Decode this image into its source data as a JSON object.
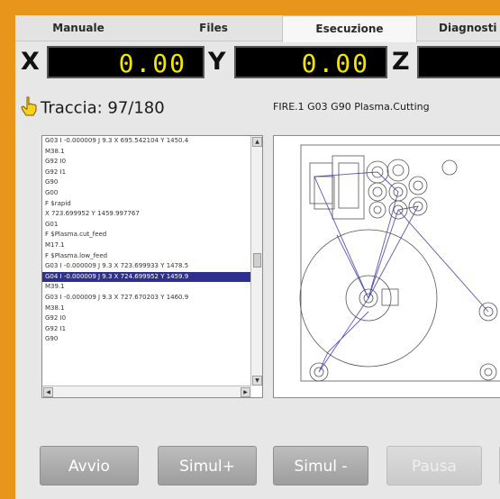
{
  "tabs": [
    {
      "label": "Manuale"
    },
    {
      "label": "Files"
    },
    {
      "label": "Esecuzione"
    },
    {
      "label": "Diagnosti"
    }
  ],
  "active_tab": "Esecuzione",
  "dro": {
    "x": {
      "axis": "X",
      "value": "0.00"
    },
    "y": {
      "axis": "Y",
      "value": "0.00"
    },
    "z": {
      "axis": "Z",
      "value": ""
    }
  },
  "trace": {
    "label": "Traccia: 97/180",
    "icon": "hand-pointer-icon"
  },
  "status_line": "FIRE.1  G03  G90  Plasma.Cutting",
  "gcode_lines": [
    "G03 I -0.000009 J 9.3 X 695.542104 Y 1450.4",
    "M38.1",
    "G92 I0",
    "G92 I1",
    "G90",
    "G00",
    "F $rapid",
    "X 723.699952 Y 1459.997767",
    "G01",
    "F $Plasma.cut_feed",
    "M17.1",
    "F $Plasma.low_feed",
    "G03 I -0.000009 J 9.3 X 723.699933 Y 1478.5",
    "G04 I -0.000009 J 9.3 X 724.699952 Y 1459.9",
    "M39.1",
    "G03 I -0.000009 J 9.3 X 727.670203 Y 1460.9",
    "M38.1",
    "G92 I0",
    "G92 I1",
    "G90"
  ],
  "selected_line_index": 13,
  "buttons": {
    "start": "Avvio",
    "sim_plus": "Simul+",
    "sim_minus": "Simul -",
    "pause": "Pausa"
  },
  "colors": {
    "frame": "#e8951c",
    "dro_background": "#000000",
    "dro_digits": "#f2e600",
    "selection": "#2f2f8c"
  }
}
